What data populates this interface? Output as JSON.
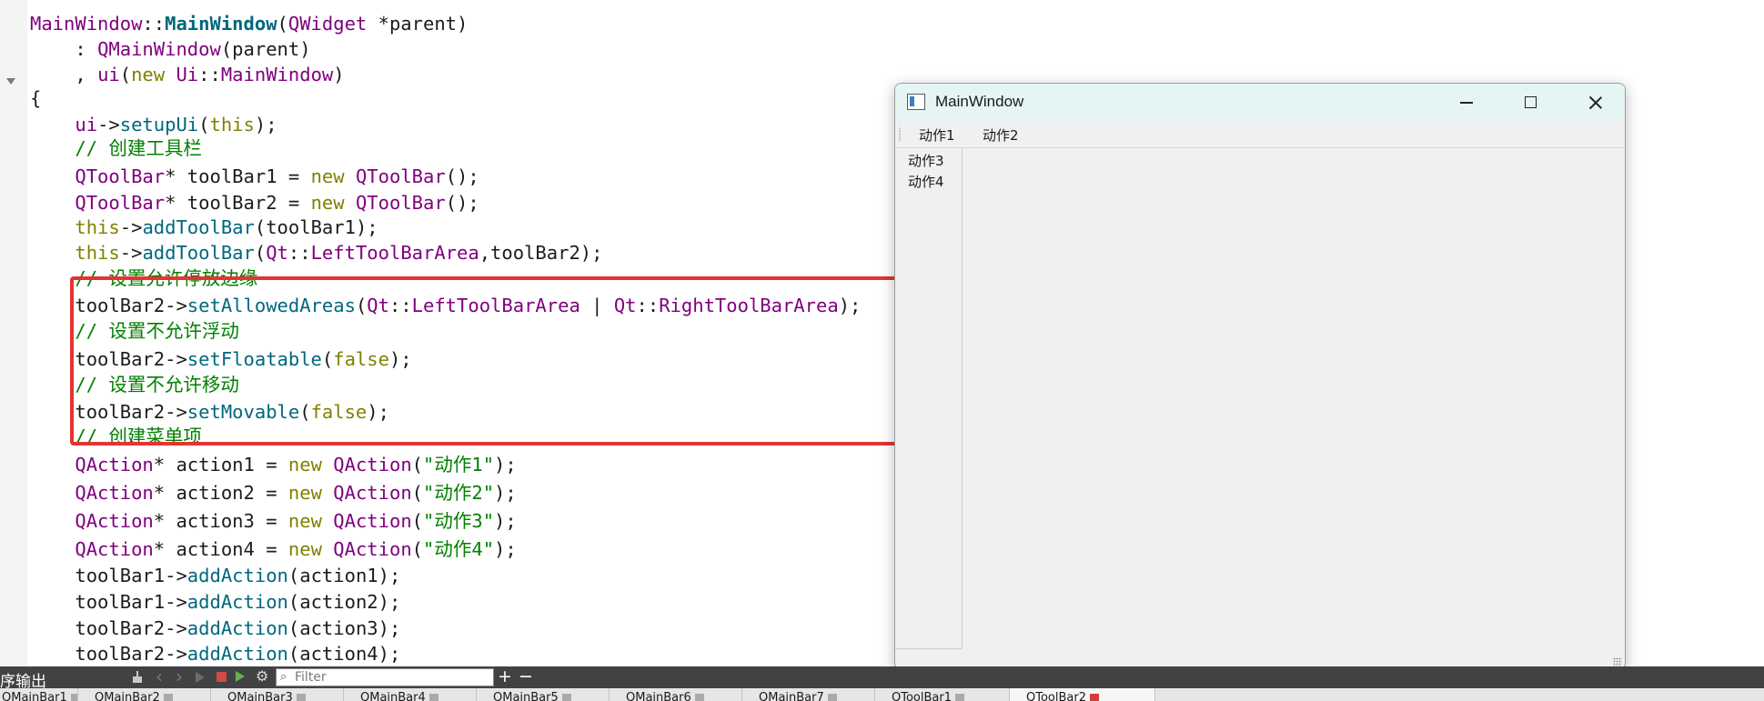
{
  "code": {
    "lines": [
      [
        [
          "t",
          "MainWindow"
        ],
        [
          "p",
          "::"
        ],
        [
          "fb",
          "MainWindow"
        ],
        [
          "p",
          "("
        ],
        [
          "t",
          "QWidget"
        ],
        [
          "p",
          " *parent)"
        ]
      ],
      [
        [
          "p",
          "    : "
        ],
        [
          "t",
          "QMainWindow"
        ],
        [
          "p",
          "(parent)"
        ]
      ],
      [
        [
          "p",
          "    , "
        ],
        [
          "t",
          "ui"
        ],
        [
          "p",
          "("
        ],
        [
          "k",
          "new"
        ],
        [
          "p",
          " "
        ],
        [
          "t",
          "Ui"
        ],
        [
          "p",
          "::"
        ],
        [
          "t",
          "MainWindow"
        ],
        [
          "p",
          ")"
        ]
      ],
      [
        [
          "p",
          "{"
        ]
      ],
      [
        [
          "p",
          "    "
        ],
        [
          "t",
          "ui"
        ],
        [
          "p",
          "->"
        ],
        [
          "f",
          "setupUi"
        ],
        [
          "p",
          "("
        ],
        [
          "k",
          "this"
        ],
        [
          "p",
          ");"
        ]
      ],
      [
        [
          "c",
          "    // 创建工具栏"
        ]
      ],
      [
        [
          "p",
          "    "
        ],
        [
          "t",
          "QToolBar"
        ],
        [
          "p",
          "* toolBar1 = "
        ],
        [
          "k",
          "new"
        ],
        [
          "p",
          " "
        ],
        [
          "t",
          "QToolBar"
        ],
        [
          "p",
          "();"
        ]
      ],
      [
        [
          "p",
          "    "
        ],
        [
          "t",
          "QToolBar"
        ],
        [
          "p",
          "* toolBar2 = "
        ],
        [
          "k",
          "new"
        ],
        [
          "p",
          " "
        ],
        [
          "t",
          "QToolBar"
        ],
        [
          "p",
          "();"
        ]
      ],
      [
        [
          "p",
          "    "
        ],
        [
          "k",
          "this"
        ],
        [
          "p",
          "->"
        ],
        [
          "f",
          "addToolBar"
        ],
        [
          "p",
          "(toolBar1);"
        ]
      ],
      [
        [
          "p",
          "    "
        ],
        [
          "k",
          "this"
        ],
        [
          "p",
          "->"
        ],
        [
          "f",
          "addToolBar"
        ],
        [
          "p",
          "("
        ],
        [
          "t",
          "Qt"
        ],
        [
          "p",
          "::"
        ],
        [
          "t",
          "LeftToolBarArea"
        ],
        [
          "p",
          ",toolBar2);"
        ]
      ],
      [
        [
          "c",
          "    // 设置允许停放边缘"
        ]
      ],
      [
        [
          "p",
          "    toolBar2->"
        ],
        [
          "f",
          "setAllowedAreas"
        ],
        [
          "p",
          "("
        ],
        [
          "t",
          "Qt"
        ],
        [
          "p",
          "::"
        ],
        [
          "t",
          "LeftToolBarArea"
        ],
        [
          "p",
          " | "
        ],
        [
          "t",
          "Qt"
        ],
        [
          "p",
          "::"
        ],
        [
          "t",
          "RightToolBarArea"
        ],
        [
          "p",
          ");"
        ]
      ],
      [
        [
          "c",
          "    // 设置不允许浮动"
        ]
      ],
      [
        [
          "p",
          "    toolBar2->"
        ],
        [
          "f",
          "setFloatable"
        ],
        [
          "p",
          "("
        ],
        [
          "k",
          "false"
        ],
        [
          "p",
          ");"
        ]
      ],
      [
        [
          "c",
          "    // 设置不允许移动"
        ]
      ],
      [
        [
          "p",
          "    toolBar2->"
        ],
        [
          "f",
          "setMovable"
        ],
        [
          "p",
          "("
        ],
        [
          "k",
          "false"
        ],
        [
          "p",
          ");"
        ]
      ],
      [
        [
          "c",
          "    // 创建菜单项"
        ]
      ],
      [
        [
          "p",
          "    "
        ],
        [
          "t",
          "QAction"
        ],
        [
          "p",
          "* action1 = "
        ],
        [
          "k",
          "new"
        ],
        [
          "p",
          " "
        ],
        [
          "t",
          "QAction"
        ],
        [
          "p",
          "("
        ],
        [
          "s",
          "\"动作1\""
        ],
        [
          "p",
          ");"
        ]
      ],
      [
        [
          "p",
          "    "
        ],
        [
          "t",
          "QAction"
        ],
        [
          "p",
          "* action2 = "
        ],
        [
          "k",
          "new"
        ],
        [
          "p",
          " "
        ],
        [
          "t",
          "QAction"
        ],
        [
          "p",
          "("
        ],
        [
          "s",
          "\"动作2\""
        ],
        [
          "p",
          ");"
        ]
      ],
      [
        [
          "p",
          "    "
        ],
        [
          "t",
          "QAction"
        ],
        [
          "p",
          "* action3 = "
        ],
        [
          "k",
          "new"
        ],
        [
          "p",
          " "
        ],
        [
          "t",
          "QAction"
        ],
        [
          "p",
          "("
        ],
        [
          "s",
          "\"动作3\""
        ],
        [
          "p",
          ");"
        ]
      ],
      [
        [
          "p",
          "    "
        ],
        [
          "t",
          "QAction"
        ],
        [
          "p",
          "* action4 = "
        ],
        [
          "k",
          "new"
        ],
        [
          "p",
          " "
        ],
        [
          "t",
          "QAction"
        ],
        [
          "p",
          "("
        ],
        [
          "s",
          "\"动作4\""
        ],
        [
          "p",
          ");"
        ]
      ],
      [
        [
          "p",
          "    toolBar1->"
        ],
        [
          "f",
          "addAction"
        ],
        [
          "p",
          "(action1);"
        ]
      ],
      [
        [
          "p",
          "    toolBar1->"
        ],
        [
          "f",
          "addAction"
        ],
        [
          "p",
          "(action2);"
        ]
      ],
      [
        [
          "p",
          "    toolBar2->"
        ],
        [
          "f",
          "addAction"
        ],
        [
          "p",
          "(action3);"
        ]
      ],
      [
        [
          "p",
          "    toolBar2->"
        ],
        [
          "f",
          "addAction"
        ],
        [
          "p",
          "(action4);"
        ]
      ]
    ]
  },
  "app_window": {
    "title": "MainWindow",
    "top_toolbar": [
      "动作1",
      "动作2"
    ],
    "left_toolbar": [
      "动作3",
      "动作4"
    ]
  },
  "output_pane": {
    "title": "序输出",
    "filter_placeholder": "Filter",
    "plus": "+",
    "minus": "−",
    "tabs": [
      "QMainBar1",
      "QMainBar2",
      "QMainBar3",
      "QMainBar4",
      "QMainBar5",
      "QMainBar6",
      "QMainBar7",
      "QToolBar1",
      "QToolBar2"
    ],
    "active_tab": 8
  }
}
